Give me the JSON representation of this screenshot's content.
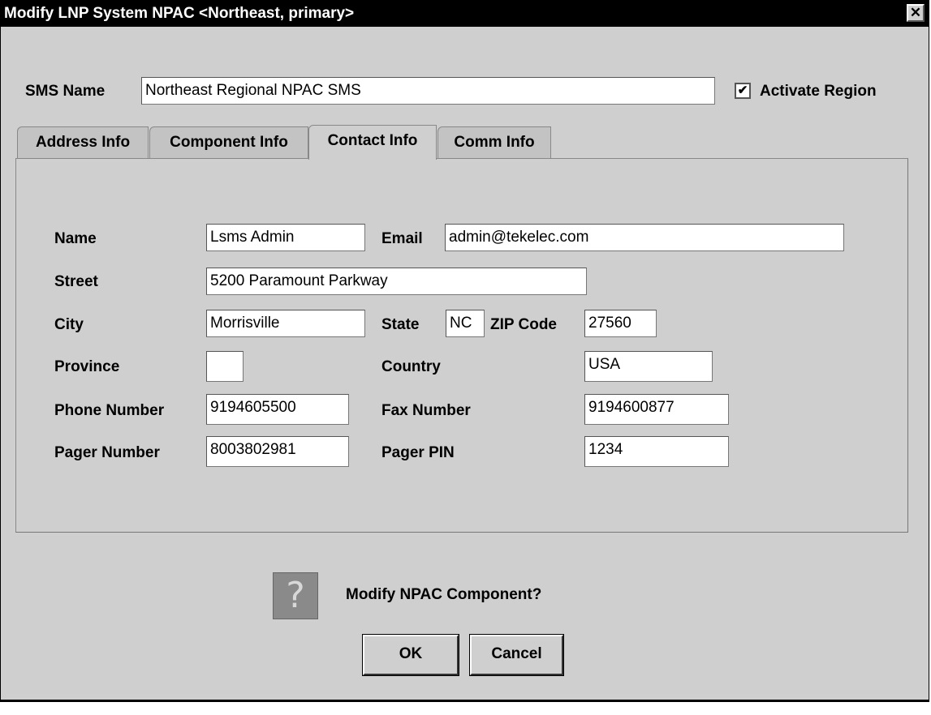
{
  "window": {
    "title": "Modify LNP System NPAC <Northeast,  primary>",
    "close_glyph": "✕"
  },
  "sms": {
    "label": "SMS Name",
    "value": "Northeast Regional NPAC SMS"
  },
  "activate": {
    "label": "Activate Region",
    "checked_glyph": "✔"
  },
  "tabs": [
    {
      "label": "Address Info"
    },
    {
      "label": "Component Info"
    },
    {
      "label": "Contact Info"
    },
    {
      "label": "Comm Info"
    }
  ],
  "contact": {
    "name": {
      "label": "Name",
      "value": "Lsms Admin"
    },
    "email": {
      "label": "Email",
      "value": "admin@tekelec.com"
    },
    "street": {
      "label": "Street",
      "value": "5200 Paramount Parkway"
    },
    "city": {
      "label": "City",
      "value": "Morrisville"
    },
    "state": {
      "label": "State",
      "value": "NC"
    },
    "zip": {
      "label": "ZIP Code",
      "value": "27560"
    },
    "province": {
      "label": "Province",
      "value": ""
    },
    "country": {
      "label": "Country",
      "value": "USA"
    },
    "phone": {
      "label": "Phone Number",
      "value": "9194605500"
    },
    "fax": {
      "label": "Fax Number",
      "value": "9194600877"
    },
    "pager": {
      "label": "Pager Number",
      "value": "8003802981"
    },
    "pin": {
      "label": "Pager PIN",
      "value": "1234"
    }
  },
  "confirm": {
    "question": "Modify NPAC Component?",
    "icon_glyph": "?"
  },
  "buttons": {
    "ok": "OK",
    "cancel": "Cancel"
  }
}
